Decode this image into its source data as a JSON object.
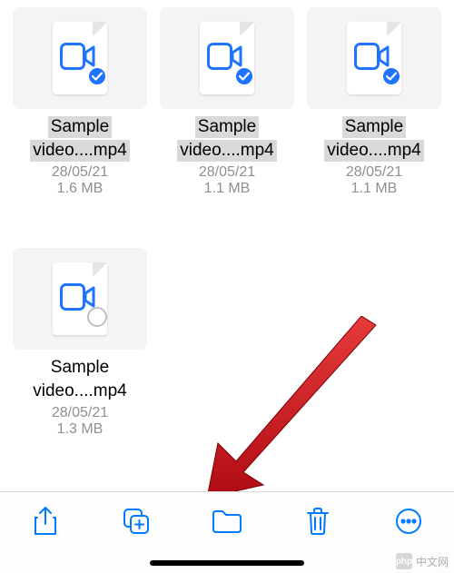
{
  "files": [
    {
      "name_l1": "Sample",
      "name_l2": "video....mp4",
      "date": "28/05/21",
      "size": "1.6 MB",
      "selected": true
    },
    {
      "name_l1": "Sample",
      "name_l2": "video....mp4",
      "date": "28/05/21",
      "size": "1.1 MB",
      "selected": true
    },
    {
      "name_l1": "Sample",
      "name_l2": "video....mp4",
      "date": "28/05/21",
      "size": "1.1 MB",
      "selected": true
    },
    {
      "name_l1": "Sample",
      "name_l2": "video....mp4",
      "date": "28/05/21",
      "size": "1.3 MB",
      "selected": false
    }
  ],
  "toolbar": {
    "share": "share-icon",
    "duplicate": "duplicate-icon",
    "move": "folder-icon",
    "delete": "trash-icon",
    "more": "more-icon"
  },
  "colors": {
    "accent": "#007aff",
    "video_icon": "#1e74ff",
    "selection_bg": "#d9d9dc",
    "muted": "#8f8f94",
    "arrow": "#c8141d"
  },
  "watermark": {
    "logo": "php",
    "text": "中文网"
  }
}
